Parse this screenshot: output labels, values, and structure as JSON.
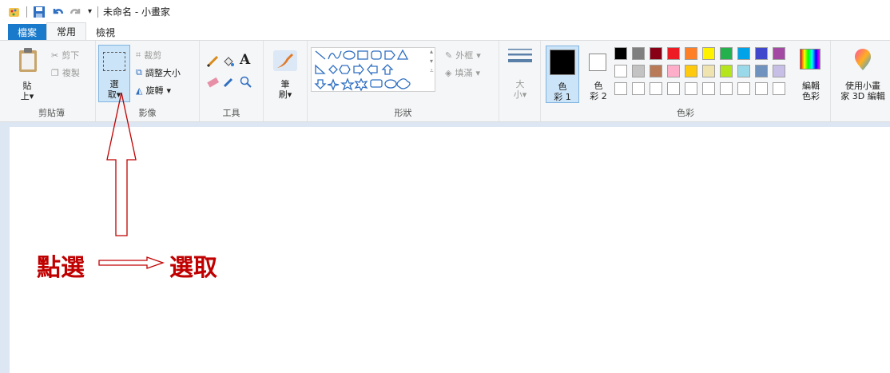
{
  "window": {
    "title": "未命名 - 小畫家"
  },
  "tabs": [
    {
      "label": "檔案"
    },
    {
      "label": "常用"
    },
    {
      "label": "檢視"
    }
  ],
  "ribbon": {
    "clipboard": {
      "group_label": "剪貼簿",
      "paste_line1": "貼",
      "paste_line2": "上",
      "cut": "剪下",
      "copy": "複製"
    },
    "image": {
      "group_label": "影像",
      "select_line1": "選",
      "select_line2": "取",
      "crop": "裁剪",
      "resize": "調整大小",
      "rotate": "旋轉"
    },
    "tools": {
      "group_label": "工具"
    },
    "brushes": {
      "line1": "筆",
      "line2": "刷"
    },
    "shapes": {
      "group_label": "形狀",
      "outline": "外框",
      "fill": "填滿"
    },
    "size": {
      "line1": "大",
      "line2": "小"
    },
    "colors": {
      "group_label": "色彩",
      "color1_line1": "色",
      "color1_line2": "彩 1",
      "color2_line1": "色",
      "color2_line2": "彩 2",
      "edit_line1": "編輯",
      "edit_line2": "色彩",
      "color1_value": "#000000",
      "color2_value": "#ffffff",
      "palette_row1": [
        "#000000",
        "#7f7f7f",
        "#880015",
        "#ed1c24",
        "#ff7f27",
        "#fff200",
        "#22b14c",
        "#00a2e8",
        "#3f48cc",
        "#a349a4"
      ],
      "palette_row2": [
        "#ffffff",
        "#c3c3c3",
        "#b97a57",
        "#ffaec9",
        "#ffc90e",
        "#efe4b0",
        "#b5e61d",
        "#99d9ea",
        "#7092be",
        "#c8bfe7"
      ],
      "palette_row3": [
        "#ffffff",
        "#ffffff",
        "#ffffff",
        "#ffffff",
        "#ffffff",
        "#ffffff",
        "#ffffff",
        "#ffffff",
        "#ffffff",
        "#ffffff"
      ]
    },
    "paint3d": {
      "line1": "使用小畫",
      "line2": "家 3D 編輯"
    }
  },
  "annotation": {
    "left_text": "點選",
    "right_text": "選取"
  }
}
